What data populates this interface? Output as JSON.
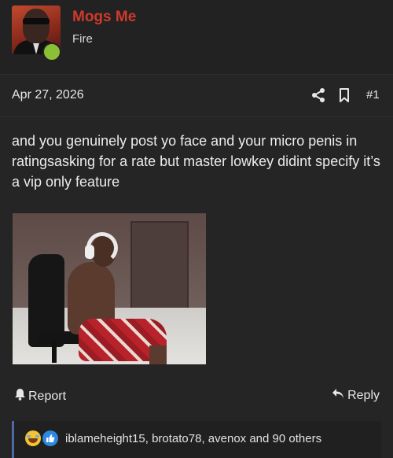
{
  "user": {
    "name": "Mogs Me",
    "title": "Fire",
    "online": true,
    "name_color": "#d0392b",
    "online_color": "#8bbf35"
  },
  "meta": {
    "date": "Apr 27, 2026",
    "post_number": "#1",
    "icons": [
      "share-icon",
      "bookmark-icon"
    ]
  },
  "post": {
    "text": "and you genuinely post yo face and your micro penis in ratingsasking for a rate but master lowkey didint specify it’s a vip only feature"
  },
  "actions": {
    "report_label": "Report",
    "reply_label": "Reply",
    "report_icon": "bell-icon",
    "reply_icon": "reply-arrow-icon"
  },
  "reactions": {
    "icons": [
      "laughing-emoji-icon",
      "thumbs-up-icon"
    ],
    "summary": "iblameheight15, brotato78, avenox and 90 others",
    "accent_color": "#4b6aa6"
  }
}
